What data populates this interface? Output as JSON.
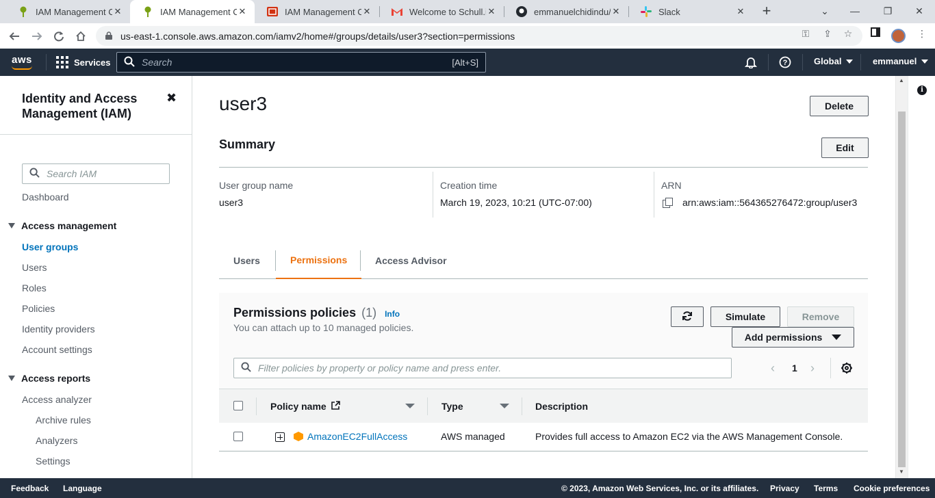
{
  "browser": {
    "tabs": [
      {
        "title": "IAM Management Co",
        "icon": "aws-iam-favicon"
      },
      {
        "title": "IAM Management Co",
        "icon": "aws-iam-favicon"
      },
      {
        "title": "IAM Management Co",
        "icon": "red-favicon"
      },
      {
        "title": "Welcome to Schull.io",
        "icon": "gmail-favicon"
      },
      {
        "title": "emmanuelchidindu/C",
        "icon": "github-favicon"
      },
      {
        "title": "Slack",
        "icon": "slack-favicon"
      }
    ],
    "close_glyph": "✕",
    "new_tab_glyph": "+",
    "url": "us-east-1.console.aws.amazon.com/iamv2/home#/groups/details/user3?section=permissions"
  },
  "aws_nav": {
    "logo": "aws",
    "services_label": "Services",
    "search_placeholder": "Search",
    "search_shortcut": "[Alt+S]",
    "region_label": "Global",
    "user_label": "emmanuel"
  },
  "sidebar": {
    "title": "Identity and Access Management (IAM)",
    "close_glyph": "✖",
    "search_placeholder": "Search IAM",
    "dashboard": "Dashboard",
    "access_management": "Access management",
    "am_items": [
      "User groups",
      "Users",
      "Roles",
      "Policies",
      "Identity providers",
      "Account settings"
    ],
    "access_reports": "Access reports",
    "access_analyzer": "Access analyzer",
    "analyzer_items": [
      "Archive rules",
      "Analyzers",
      "Settings"
    ]
  },
  "main": {
    "title": "user3",
    "delete_label": "Delete",
    "summary_heading": "Summary",
    "edit_label": "Edit",
    "summary": {
      "group_name_label": "User group name",
      "group_name_value": "user3",
      "creation_label": "Creation time",
      "creation_value": "March 19, 2023, 10:21 (UTC-07:00)",
      "arn_label": "ARN",
      "arn_value": "arn:aws:iam::564365276472:group/user3"
    },
    "tabs": [
      "Users",
      "Permissions",
      "Access Advisor"
    ],
    "active_tab": "Permissions",
    "permissions": {
      "title": "Permissions policies",
      "count": "(1)",
      "info": "Info",
      "subtitle": "You can attach up to 10 managed policies.",
      "simulate_label": "Simulate",
      "remove_label": "Remove",
      "add_label": "Add permissions",
      "filter_placeholder": "Filter policies by property or policy name and press enter.",
      "page": "1",
      "columns": [
        "Policy name",
        "Type",
        "Description"
      ],
      "rows": [
        {
          "name": "AmazonEC2FullAccess",
          "type": "AWS managed",
          "description": "Provides full access to Amazon EC2 via the AWS Management Console."
        }
      ]
    }
  },
  "footer": {
    "feedback": "Feedback",
    "language": "Language",
    "copyright": "© 2023, Amazon Web Services, Inc. or its affiliates.",
    "privacy": "Privacy",
    "terms": "Terms",
    "cookies": "Cookie preferences"
  },
  "colors": {
    "aws_nav_bg": "#232f3e",
    "link_blue": "#0073bb",
    "active_tab_orange": "#ec7211",
    "aws_orange": "#ff9900"
  }
}
